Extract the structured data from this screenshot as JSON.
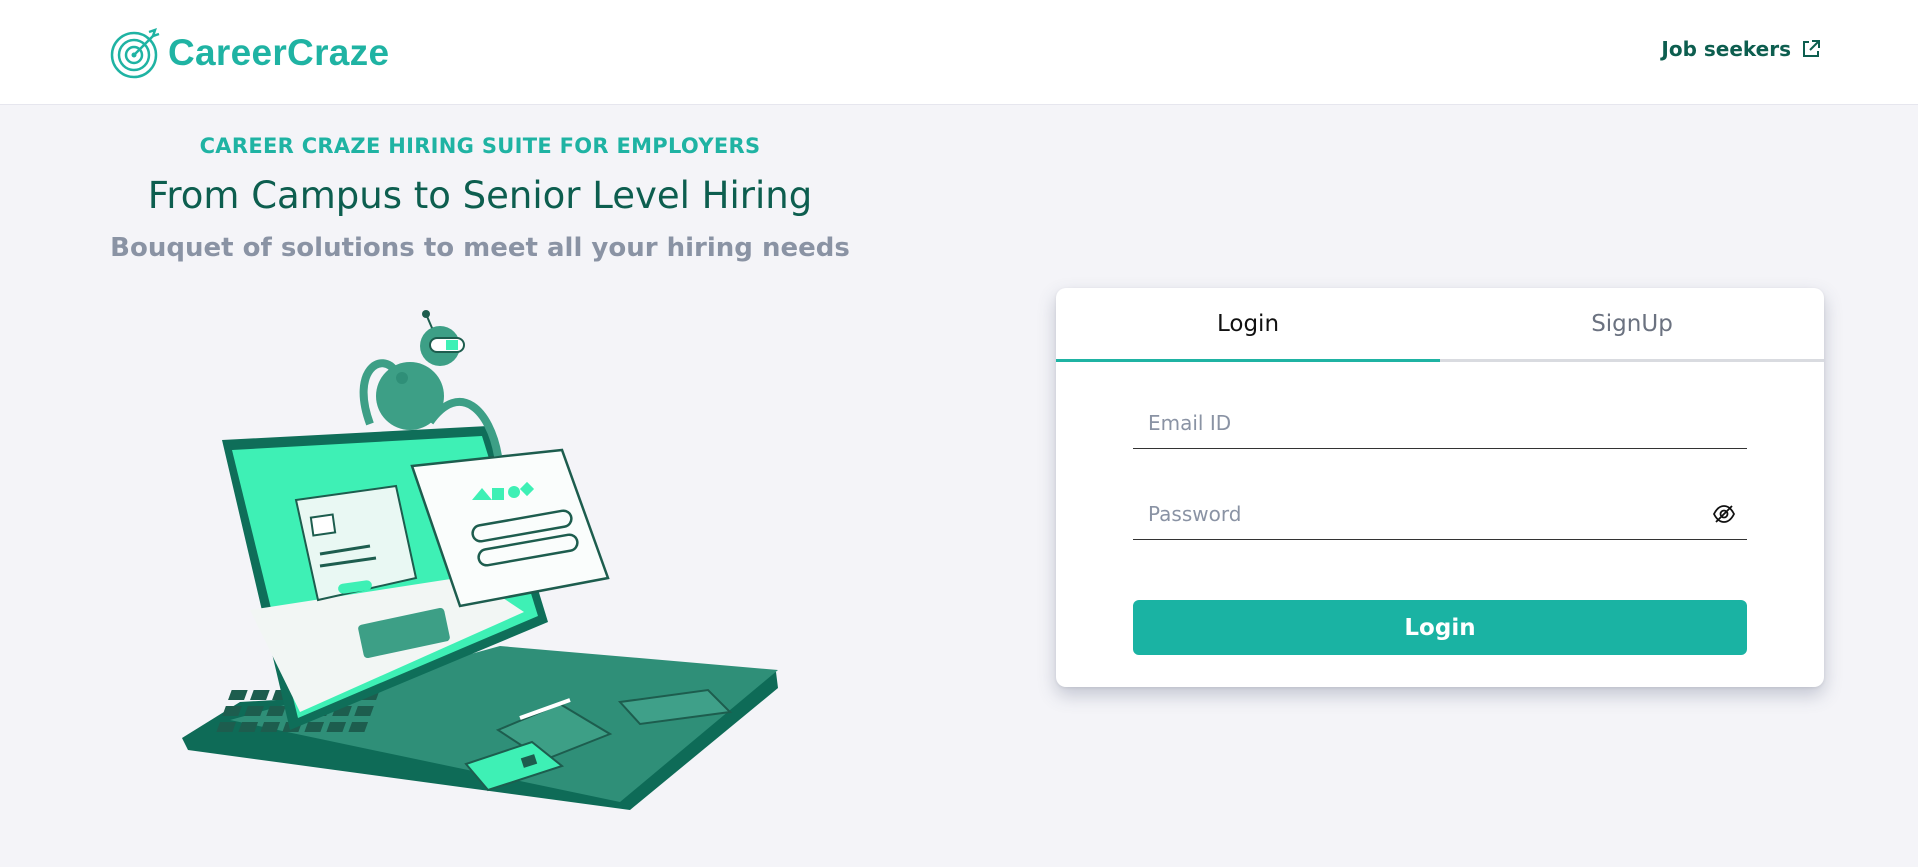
{
  "brand": {
    "name": "CareerCraze",
    "color": "#1fb3a3",
    "dark": "#0d5e4f"
  },
  "header": {
    "job_seekers_label": "Job seekers",
    "external_icon": "external-link-icon"
  },
  "hero": {
    "eyebrow": "CAREER CRAZE HIRING SUITE FOR EMPLOYERS",
    "headline": "From Campus to Senior Level Hiring",
    "subline": "Bouquet of solutions to meet all your hiring needs"
  },
  "auth": {
    "tabs": [
      {
        "label": "Login",
        "active": true
      },
      {
        "label": "SignUp",
        "active": false
      }
    ],
    "email": {
      "placeholder": "Email ID",
      "value": ""
    },
    "password": {
      "placeholder": "Password",
      "value": "",
      "toggle_icon": "eye-off-icon"
    },
    "submit_label": "Login"
  }
}
